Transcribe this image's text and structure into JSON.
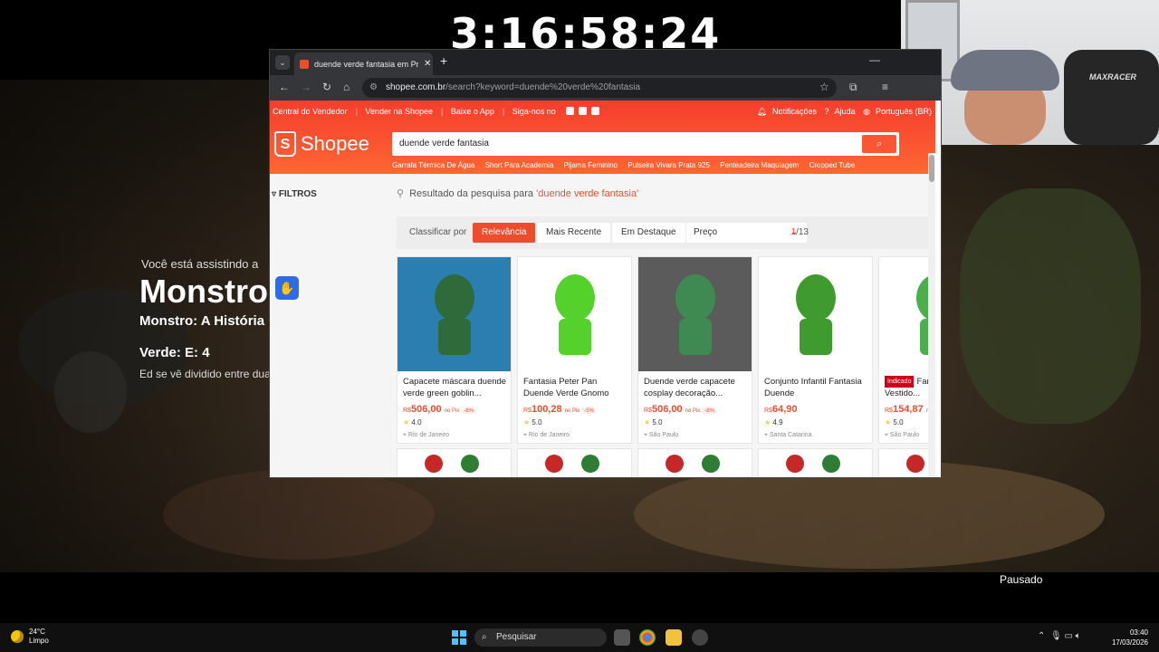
{
  "timer": "3:16:58:24",
  "video": {
    "watching_label": "Você está assistindo a",
    "show_title": "Monstros",
    "subtitle": "Monstro: A História",
    "episode": "Verde: E: 4",
    "description": "Ed se vê dividido entre dua sobre um vilão do mundo r",
    "status": "Pausado"
  },
  "webcam": {
    "chair_brand": "MAXRACER"
  },
  "browser": {
    "tab_title": "duende verde fantasia em Prom",
    "url_domain": "shopee.com.br",
    "url_path": "/search?keyword=duende%20verde%20fantasia"
  },
  "shopee": {
    "topnav": [
      "Central do Vendedor",
      "Vender na Shopee",
      "Baixe o App",
      "Siga-nos no"
    ],
    "topright": [
      "Notificações",
      "Ajuda",
      "Português (BR)"
    ],
    "logo_text": "Shopee",
    "search_value": "duende verde fantasia",
    "suggestions": [
      "Garrafa Térmica De Água",
      "Short Para Academia",
      "Pijama Feminino",
      "Pulseira Vivara Prata 925",
      "Penteadeira Maquiagem",
      "Cropped Tube"
    ],
    "filters_label": "FILTROS",
    "result_prefix": "Resultado da pesquisa para",
    "result_keyword": "'duende verde fantasia'",
    "sort": {
      "label": "Classificar por",
      "options": [
        "Relevância",
        "Mais Recente",
        "Em Destaque"
      ],
      "active": "Relevância",
      "price_label": "Preço"
    },
    "pager": {
      "current": "1",
      "total": "/13"
    },
    "products": [
      {
        "name": "Capacete máscara duende verde green goblin...",
        "currency": "R$",
        "price": "506,00",
        "pix": "no Pix",
        "discount": "-8%",
        "rating": "4.0",
        "location": "Rio de Janeiro",
        "tag": "",
        "img_color": "#2f6b3a",
        "bg_color": "#2b7fb0"
      },
      {
        "name": "Fantasia Peter Pan Duende Verde Gnomo Adulto",
        "currency": "R$",
        "price": "100,28",
        "pix": "no Pix",
        "discount": "-5%",
        "rating": "5.0",
        "location": "Rio de Janeiro",
        "tag": "",
        "img_color": "#55d12b",
        "bg_color": "#ffffff"
      },
      {
        "name": "Duende verde capacete cosplay decoração...",
        "currency": "R$",
        "price": "506,00",
        "pix": "no Pix",
        "discount": "-8%",
        "rating": "5.0",
        "location": "São Paulo",
        "tag": "",
        "img_color": "#3e8a52",
        "bg_color": "#5b5b5b"
      },
      {
        "name": "Conjunto Infantil Fantasia Duende",
        "currency": "R$",
        "price": "64,90",
        "pix": "",
        "discount": "",
        "rating": "4.9",
        "location": "Santa Catarina",
        "tag": "",
        "img_color": "#3f9b2d",
        "bg_color": "#ffffff"
      },
      {
        "name": "Fantasia Feminina Vestido...",
        "currency": "R$",
        "price": "154,87",
        "pix": "no Pix",
        "discount": "",
        "rating": "5.0",
        "location": "São Paulo",
        "tag": "Indicado",
        "img_color": "#4cae4c",
        "bg_color": "#ffffff"
      }
    ]
  },
  "taskbar": {
    "temp": "24°C",
    "weather": "Limpo",
    "search_placeholder": "Pesquisar",
    "time": "03:40",
    "date": "17/03/2026"
  }
}
